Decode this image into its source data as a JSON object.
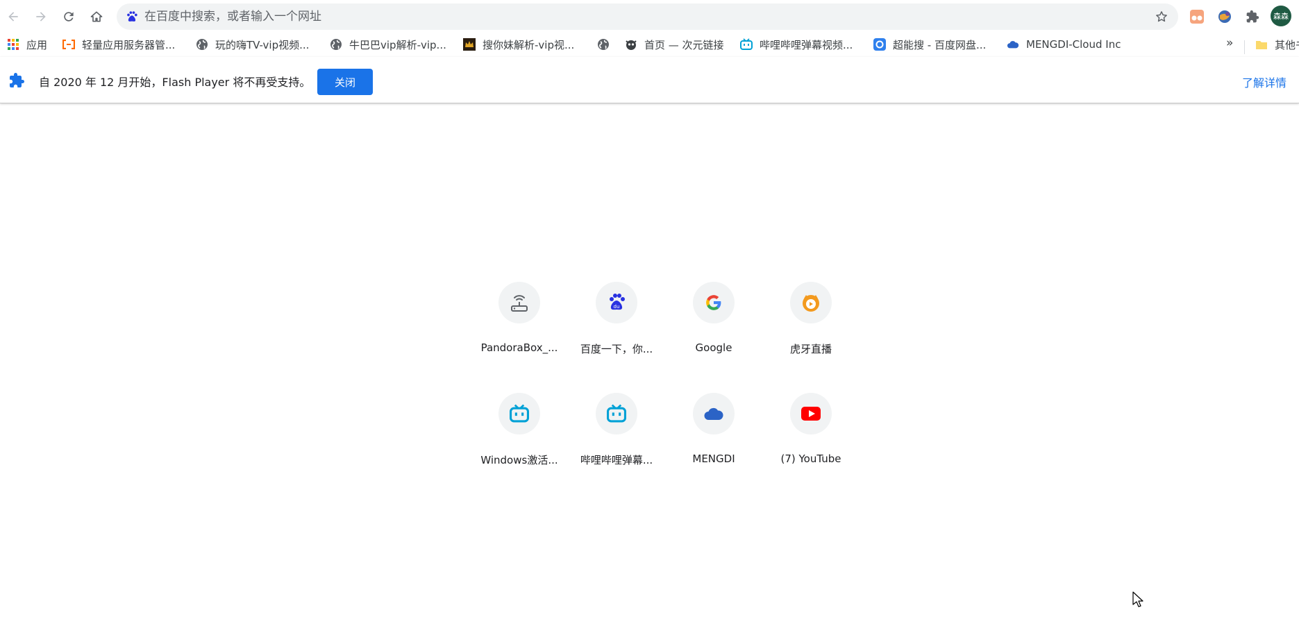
{
  "toolbar": {
    "back_icon": "arrow-left-icon",
    "forward_icon": "arrow-right-icon",
    "reload_icon": "reload-icon",
    "home_icon": "home-icon",
    "search_engine_icon": "baidu-paw-icon",
    "omnibox_value": "",
    "omnibox_placeholder": "在百度中搜索，或者输入一个网址",
    "star_icon": "star-outline-icon",
    "extensions": [
      "tampermonkey-icon",
      "globe-extension-icon",
      "puzzle-extensions-icon"
    ],
    "profile_label": "森森"
  },
  "bookmarks": {
    "items": [
      {
        "label": "应用",
        "icon": "apps-grid-icon"
      },
      {
        "label": "轻量应用服务器管...",
        "icon": "aliyun-icon"
      },
      {
        "label": "玩的嗨TV-vip视频...",
        "icon": "globe-icon"
      },
      {
        "label": "牛巴巴vip解析-vip...",
        "icon": "globe-icon"
      },
      {
        "label": "搜你妹解析-vip视...",
        "icon": "crown-icon"
      },
      {
        "label": "",
        "icon": "globe-icon"
      },
      {
        "label": "首页 — 次元链接",
        "icon": "dog-icon"
      },
      {
        "label": "哔哩哔哩弹幕视频...",
        "icon": "bilibili-icon"
      },
      {
        "label": "超能搜 - 百度网盘...",
        "icon": "search-app-icon"
      },
      {
        "label": "MENGDI-Cloud Inc",
        "icon": "cloud-icon"
      }
    ],
    "more_label": "»",
    "other_label": "其他书"
  },
  "infobar": {
    "message": "自 2020 年 12 月开始，Flash Player 将不再受支持。",
    "close_label": "关闭",
    "learn_more_label": "了解详情"
  },
  "shortcuts": [
    {
      "title": "PandoraBox_...",
      "icon": "router-icon"
    },
    {
      "title": "百度一下，你...",
      "icon": "baidu-icon"
    },
    {
      "title": "Google",
      "icon": "google-icon"
    },
    {
      "title": "虎牙直播",
      "icon": "huya-icon"
    },
    {
      "title": "Windows激活...",
      "icon": "bilibili-icon"
    },
    {
      "title": "哔哩哔哩弹幕...",
      "icon": "bilibili-icon"
    },
    {
      "title": "MENGDI",
      "icon": "cloud-icon"
    },
    {
      "title": "(7) YouTube",
      "icon": "youtube-icon"
    }
  ],
  "colors": {
    "accent": "#1a73e8",
    "omnibox_bg": "#f1f3f4",
    "tile_bg": "#f1f3f4",
    "profile_bg": "#1f5a43"
  }
}
